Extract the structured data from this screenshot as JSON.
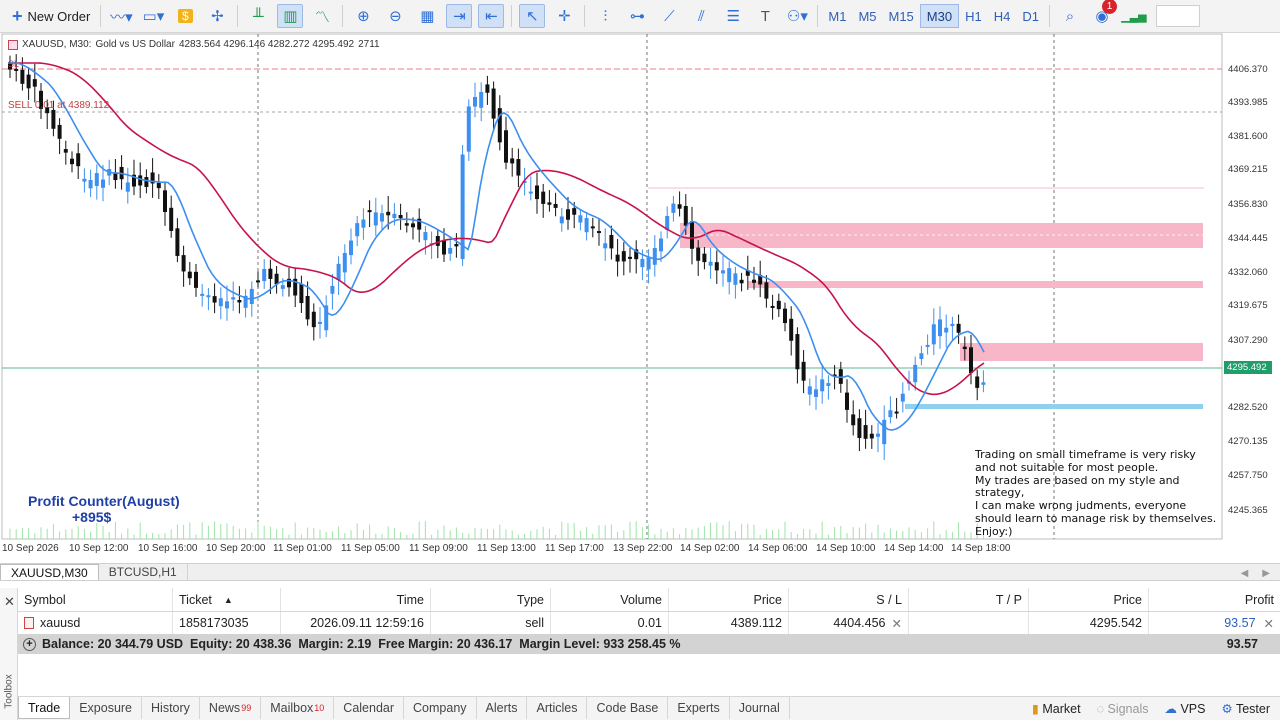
{
  "toolbar": {
    "new_order_label": "New Order",
    "timeframes": [
      "M1",
      "M5",
      "M15",
      "M30",
      "H1",
      "H4",
      "D1"
    ],
    "selected_timeframe": "M30",
    "notification_count": "1"
  },
  "chart": {
    "header": {
      "symbol": "XAUUSD, M30:",
      "description": "Gold vs US Dollar",
      "ohlc": "4283.564 4296.146 4282.272 4295.492",
      "volume": "2711"
    },
    "order_line_label": "SELL 0.01 at 4389.112",
    "sl_label": "SL",
    "price_axis": [
      "4406.370",
      "4393.985",
      "4381.600",
      "4369.215",
      "4356.830",
      "4344.445",
      "4332.060",
      "4319.675",
      "4307.290",
      "4282.520",
      "4270.135",
      "4257.750",
      "4245.365"
    ],
    "current_price": "4295.492",
    "time_axis": [
      "10 Sep 2026",
      "10 Sep 12:00",
      "10 Sep 16:00",
      "10 Sep 20:00",
      "11 Sep 01:00",
      "11 Sep 05:00",
      "11 Sep 09:00",
      "11 Sep 13:00",
      "11 Sep 17:00",
      "13 Sep 22:00",
      "14 Sep 02:00",
      "14 Sep 06:00",
      "14 Sep 10:00",
      "14 Sep 14:00",
      "14 Sep 18:00"
    ],
    "profit_counter": {
      "title": "Profit Counter(August)",
      "value": "+895$"
    },
    "note": [
      "Trading on small timeframe is very risky",
      "and not suitable for most people.",
      "My trades are based on my style and strategy,",
      "I can make wrong judments, everyone",
      "should learn to manage risk by themselves.",
      "Enjoy:)"
    ],
    "colors": {
      "bull": "#3d8ff0",
      "bear": "#111111",
      "ma_fast": "#3d8ff0",
      "ma_slow": "#c8134a",
      "zone_supply": "#f8b6c9",
      "zone_demand": "#8fd0ef"
    }
  },
  "chart_tabs": [
    "XAUUSD,M30",
    "BTCUSD,H1"
  ],
  "trade": {
    "columns": [
      "Symbol",
      "Ticket",
      "Time",
      "Type",
      "Volume",
      "Price",
      "S / L",
      "T / P",
      "Price",
      "Profit"
    ],
    "rows": [
      {
        "symbol": "xauusd",
        "ticket": "1858173035",
        "time": "2026.09.11 12:59:16",
        "type": "sell",
        "volume": "0.01",
        "price": "4389.112",
        "sl": "4404.456",
        "tp": "",
        "current_price": "4295.542",
        "profit": "93.57"
      }
    ],
    "summary": "Balance: 20 344.79 USD  Equity: 20 438.36  Margin: 2.19  Free Margin: 20 436.17  Margin Level: 933 258.45 %",
    "total": "93.57"
  },
  "toolbox_label": "Toolbox",
  "bottom_tabs": [
    {
      "label": "Trade",
      "badge": ""
    },
    {
      "label": "Exposure",
      "badge": ""
    },
    {
      "label": "History",
      "badge": ""
    },
    {
      "label": "News",
      "badge": "99"
    },
    {
      "label": "Mailbox",
      "badge": "10"
    },
    {
      "label": "Calendar",
      "badge": ""
    },
    {
      "label": "Company",
      "badge": ""
    },
    {
      "label": "Alerts",
      "badge": ""
    },
    {
      "label": "Articles",
      "badge": ""
    },
    {
      "label": "Code Base",
      "badge": ""
    },
    {
      "label": "Experts",
      "badge": ""
    },
    {
      "label": "Journal",
      "badge": ""
    }
  ],
  "status": {
    "market": "Market",
    "signals": "Signals",
    "vps": "VPS",
    "tester": "Tester"
  }
}
